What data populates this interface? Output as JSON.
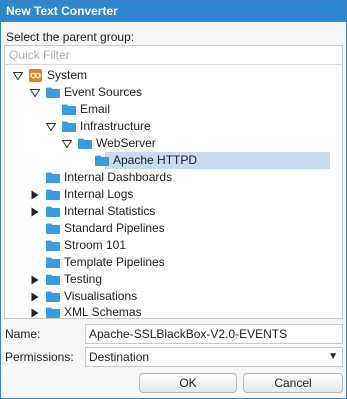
{
  "dialog": {
    "title": "New Text Converter",
    "prompt": "Select the parent group:"
  },
  "filter": {
    "placeholder": "Quick Filter",
    "value": ""
  },
  "tree": {
    "items": [
      {
        "label": "System",
        "icon": "system-icon",
        "expander": "open"
      },
      {
        "label": "Event Sources",
        "icon": "folder-icon",
        "expander": "open"
      },
      {
        "label": "Email",
        "icon": "folder-icon",
        "expander": "none"
      },
      {
        "label": "Infrastructure",
        "icon": "folder-icon",
        "expander": "open"
      },
      {
        "label": "WebServer",
        "icon": "folder-icon",
        "expander": "open"
      },
      {
        "label": "Apache HTTPD",
        "icon": "folder-icon",
        "expander": "none",
        "selected": true
      },
      {
        "label": "Internal Dashboards",
        "icon": "folder-icon",
        "expander": "none"
      },
      {
        "label": "Internal Logs",
        "icon": "folder-icon",
        "expander": "closed"
      },
      {
        "label": "Internal Statistics",
        "icon": "folder-icon",
        "expander": "closed"
      },
      {
        "label": "Standard Pipelines",
        "icon": "folder-icon",
        "expander": "none"
      },
      {
        "label": "Stroom 101",
        "icon": "folder-icon",
        "expander": "none"
      },
      {
        "label": "Template Pipelines",
        "icon": "folder-icon",
        "expander": "none"
      },
      {
        "label": "Testing",
        "icon": "folder-icon",
        "expander": "closed"
      },
      {
        "label": "Visualisations",
        "icon": "folder-icon",
        "expander": "closed"
      },
      {
        "label": "XML Schemas",
        "icon": "folder-icon",
        "expander": "closed"
      }
    ]
  },
  "form": {
    "name_label": "Name:",
    "name_value": "Apache-SSLBlackBox-V2.0-EVENTS",
    "permissions_label": "Permissions:",
    "permissions_value": "Destination"
  },
  "buttons": {
    "ok": "OK",
    "cancel": "Cancel"
  },
  "colors": {
    "titlebar": "#2f86d1",
    "selection": "#c7dcf0",
    "folder": "#3b9be0",
    "system_icon": "#f07c1e"
  }
}
